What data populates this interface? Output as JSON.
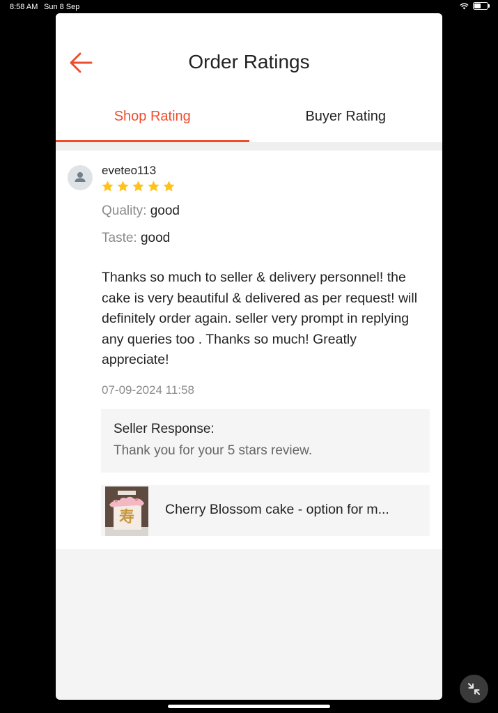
{
  "status_bar": {
    "time": "8:58 AM",
    "date": "Sun 8 Sep"
  },
  "header": {
    "title": "Order Ratings",
    "back_icon": "arrow-left-icon"
  },
  "tabs": [
    {
      "label": "Shop Rating",
      "active": true
    },
    {
      "label": "Buyer Rating",
      "active": false
    }
  ],
  "review": {
    "username": "eveteo113",
    "rating": 5,
    "attributes": [
      {
        "label": "Quality:",
        "value": "good"
      },
      {
        "label": "Taste:",
        "value": "good"
      }
    ],
    "comment": "Thanks so much to seller & delivery personnel! the cake is very beautiful & delivered as per request! will definitely order again. seller very prompt in replying any queries too . Thanks so much! Greatly appreciate!",
    "timestamp": "07-09-2024 11:58",
    "seller_response": {
      "title": "Seller Response:",
      "text": "Thank you for your 5 stars review."
    },
    "product": {
      "name": "Cherry Blossom cake - option for m..."
    }
  },
  "colors": {
    "accent": "#ee4d2d",
    "star": "#ffc21a"
  }
}
